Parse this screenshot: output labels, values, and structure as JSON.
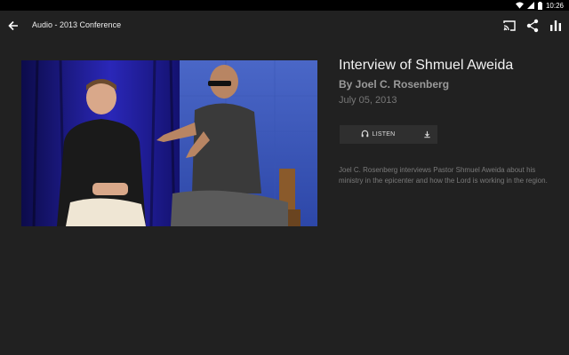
{
  "status_bar": {
    "time": "10:26"
  },
  "app_bar": {
    "title": "Audio - 2013 Conference",
    "icons": [
      "arrow-back-icon",
      "cast-icon",
      "share-icon",
      "equalizer-icon"
    ]
  },
  "media": {
    "title": "Interview of Shmuel Aweida",
    "author": "By Joel C. Rosenberg",
    "date": "July 05, 2013",
    "listen_label": "LISTEN",
    "description": "Joel C. Rosenberg interviews Pastor Shmuel Aweida about his ministry in the epicenter and how the Lord is working in the region."
  },
  "colors": {
    "background": "#212121",
    "status_bar": "#000000",
    "button_bg": "#2f2f2f"
  }
}
